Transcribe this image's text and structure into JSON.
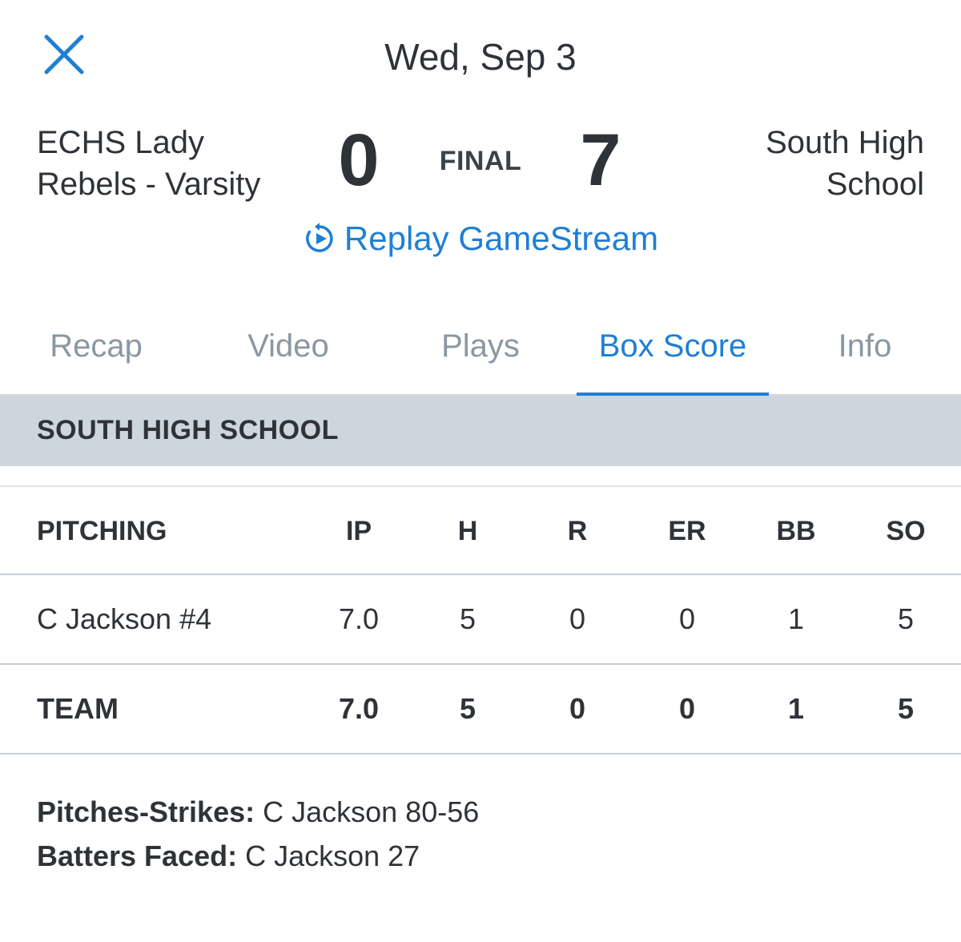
{
  "header": {
    "date": "Wed, Sep 3",
    "close_icon": "close-icon"
  },
  "game": {
    "away_team_line1": "ECHS Lady",
    "away_team_line2": "Rebels - Varsity",
    "away_score": "0",
    "status": "FINAL",
    "home_score": "7",
    "home_team_line1": "South High",
    "home_team_line2": "School"
  },
  "replay": {
    "label": "Replay GameStream",
    "icon": "replay-icon"
  },
  "tabs": [
    {
      "label": "Recap",
      "active": false
    },
    {
      "label": "Video",
      "active": false
    },
    {
      "label": "Plays",
      "active": false
    },
    {
      "label": "Box Score",
      "active": true
    },
    {
      "label": "Info",
      "active": false
    }
  ],
  "section": {
    "title": "SOUTH HIGH SCHOOL"
  },
  "pitching_table": {
    "headers": [
      "PITCHING",
      "IP",
      "H",
      "R",
      "ER",
      "BB",
      "SO"
    ],
    "rows": [
      {
        "name": "C Jackson #4",
        "ip": "7.0",
        "h": "5",
        "r": "0",
        "er": "0",
        "bb": "1",
        "so": "5"
      }
    ],
    "team": {
      "name": "TEAM",
      "ip": "7.0",
      "h": "5",
      "r": "0",
      "er": "0",
      "bb": "1",
      "so": "5"
    }
  },
  "notes": {
    "pitches_label": "Pitches-Strikes:",
    "pitches_value": " C Jackson 80-56",
    "batters_label": "Batters Faced:",
    "batters_value": " C Jackson 27"
  },
  "colors": {
    "accent": "#1f7fd4",
    "section_bg": "#cdd6dd",
    "inactive_tab": "#8b97a2",
    "text": "#2f3338"
  }
}
